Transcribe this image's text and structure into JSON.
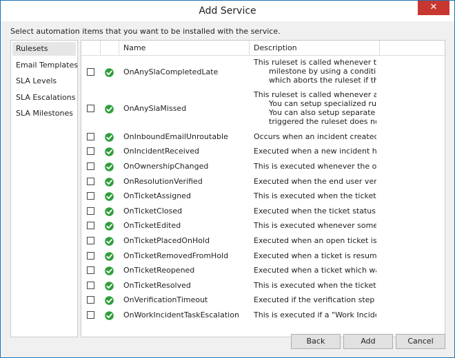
{
  "window": {
    "title": "Add Service",
    "close_glyph": "✕"
  },
  "instructions": "Select automation items that you want to be installed with the service.",
  "nav": {
    "selected": "Rulesets",
    "items": [
      "Rulesets",
      "Email Templates",
      "SLA Levels",
      "SLA Escalations",
      "SLA Milestones"
    ]
  },
  "grid": {
    "columns": [
      "Name",
      "Description"
    ],
    "rows": [
      {
        "name": "OnAnySlaCompletedLate",
        "checked": false,
        "desc": [
          "This ruleset is called whenever the re",
          "milestone by using a condition",
          "which aborts the ruleset if the s"
        ]
      },
      {
        "name": "OnAnySlaMissed",
        "checked": false,
        "desc": [
          "This ruleset is called whenever an es",
          "You can setup specialized rules",
          "You can also setup separate rul",
          "triggered the ruleset does not a"
        ]
      },
      {
        "name": "OnInboundEmailUnroutable",
        "checked": false,
        "desc": [
          "Occurs when an incident created fro"
        ]
      },
      {
        "name": "OnIncidentReceived",
        "checked": false,
        "desc": [
          "Executed when a new incident has b"
        ]
      },
      {
        "name": "OnOwnershipChanged",
        "checked": false,
        "desc": [
          "This is executed whenever the owne"
        ]
      },
      {
        "name": "OnResolutionVerified",
        "checked": false,
        "desc": [
          "Executed when the end user verifies"
        ]
      },
      {
        "name": "OnTicketAssigned",
        "checked": false,
        "desc": [
          "This is executed when the ticket is a"
        ]
      },
      {
        "name": "OnTicketClosed",
        "checked": false,
        "desc": [
          "Executed when the ticket status reac"
        ]
      },
      {
        "name": "OnTicketEdited",
        "checked": false,
        "desc": [
          "This is executed whenever someone"
        ]
      },
      {
        "name": "OnTicketPlacedOnHold",
        "checked": false,
        "desc": [
          "Executed when an open ticket is pla"
        ]
      },
      {
        "name": "OnTicketRemovedFromHold",
        "checked": false,
        "desc": [
          "Executed when a ticket is resumed a"
        ]
      },
      {
        "name": "OnTicketReopened",
        "checked": false,
        "desc": [
          "Executed when a ticket which was n"
        ]
      },
      {
        "name": "OnTicketResolved",
        "checked": false,
        "desc": [
          "This is executed when the ticket mo"
        ]
      },
      {
        "name": "OnVerificationTimeout",
        "checked": false,
        "desc": [
          "Executed if the verification step reac"
        ]
      },
      {
        "name": "OnWorkIncidentTaskEscalation",
        "checked": false,
        "desc": [
          "This is executed if a \"Work Incident\""
        ]
      }
    ]
  },
  "buttons": {
    "back": "Back",
    "add": "Add",
    "cancel": "Cancel"
  },
  "colors": {
    "accent": "#1a73b8",
    "close": "#c7372f",
    "check": "#2e9e3a"
  }
}
